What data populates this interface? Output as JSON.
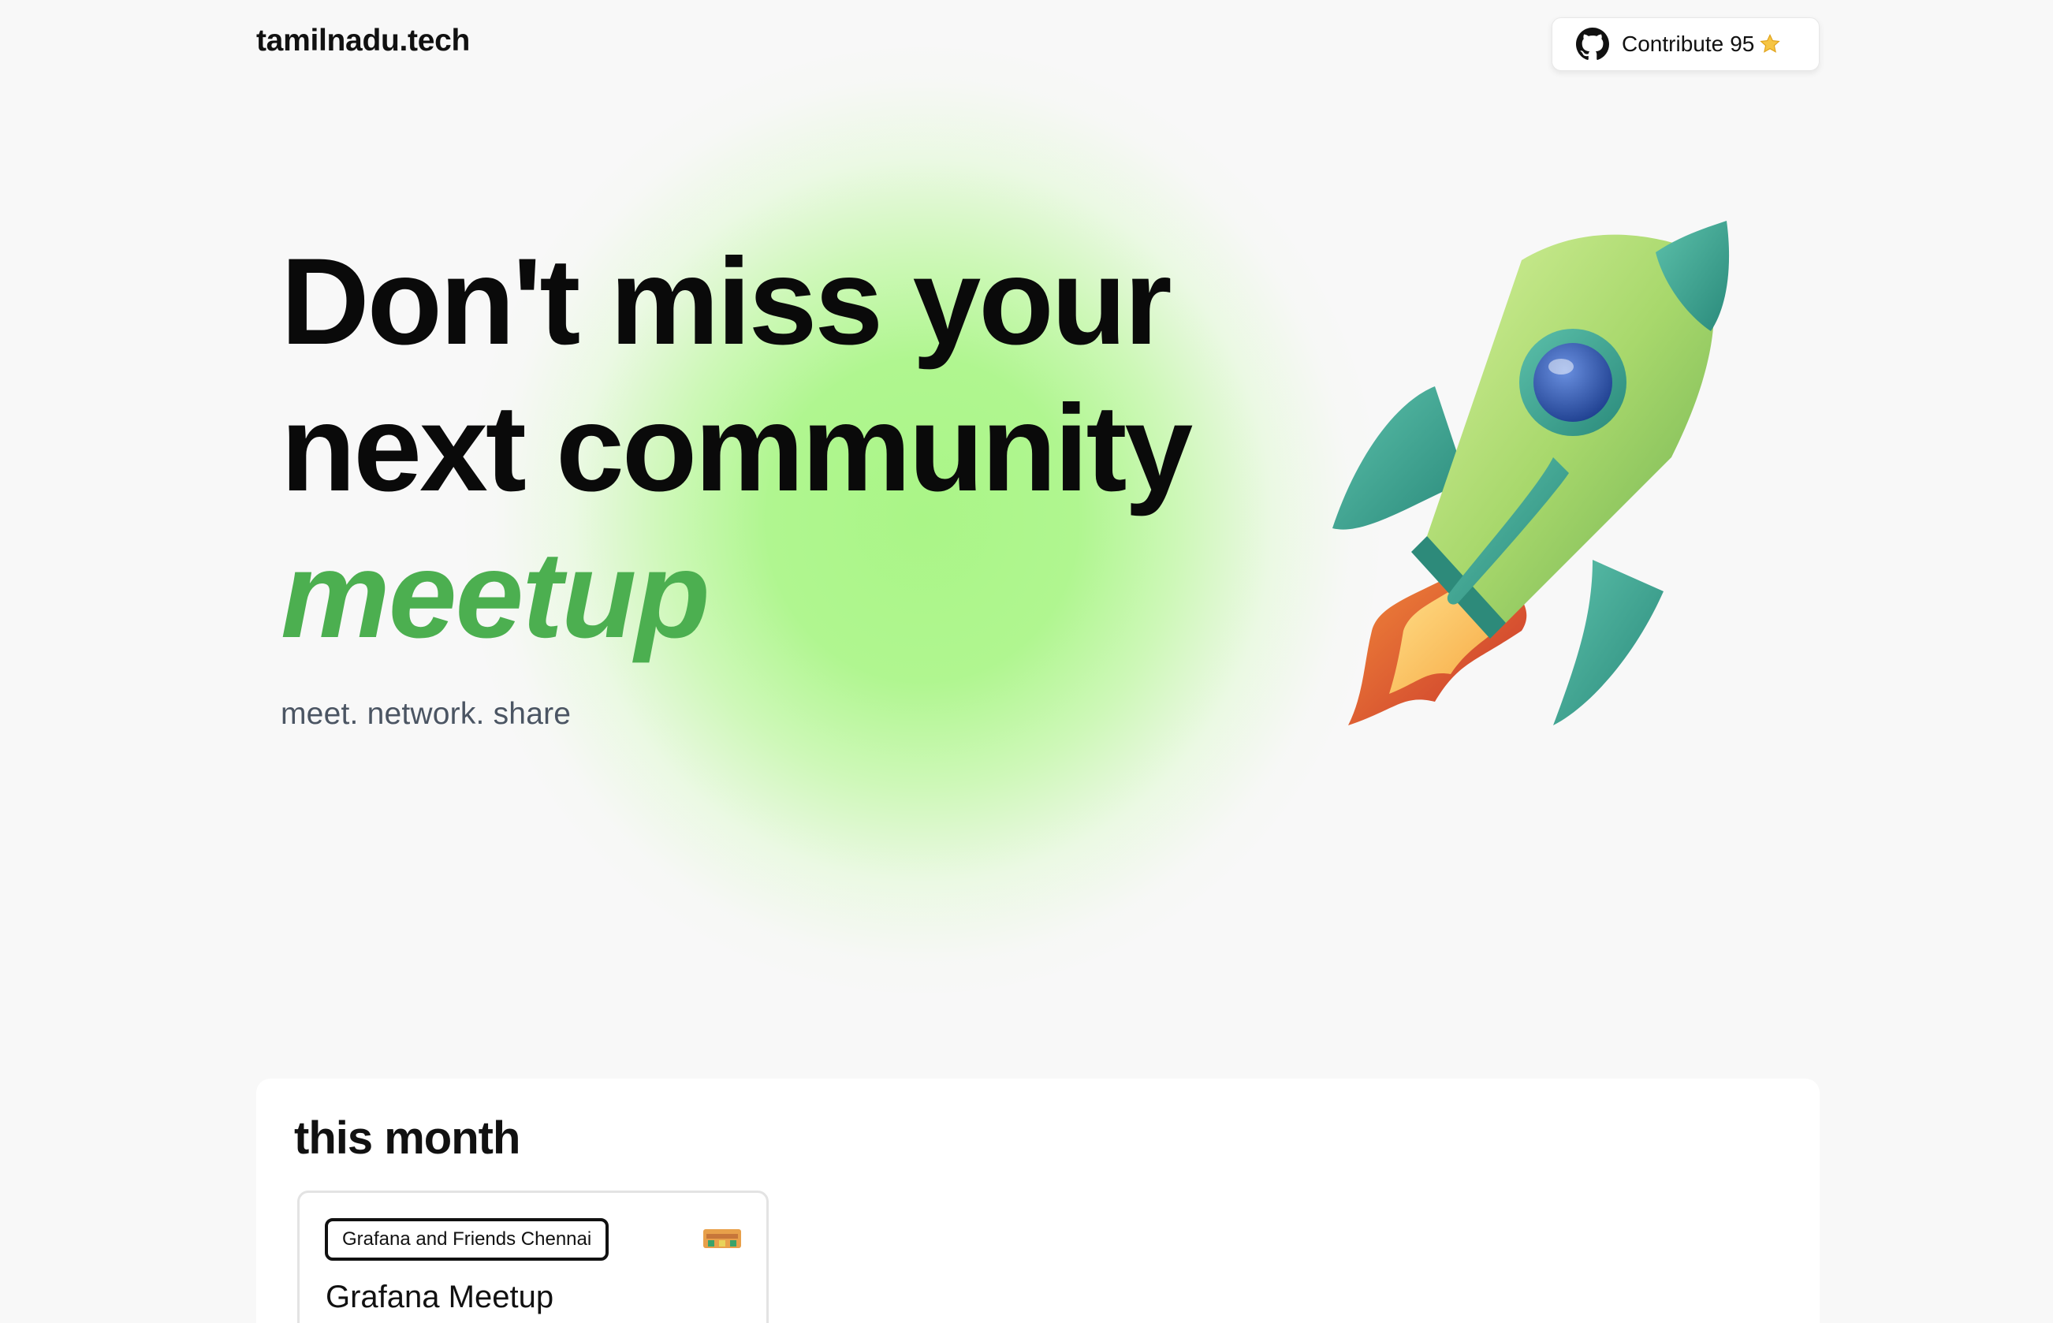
{
  "header": {
    "brand": "tamilnadu.tech",
    "contribute": {
      "label": "Contribute",
      "count": "95",
      "icon": "github-icon",
      "badge_icon": "star-icon"
    }
  },
  "hero": {
    "line1": "Don't miss your",
    "line2": "next community",
    "line3": "meetup",
    "tagline": "meet. network. share",
    "illustration": "rocket-illustration"
  },
  "this_month": {
    "title": "this month",
    "events": [
      {
        "community": "Grafana and Friends Chennai",
        "title": "Grafana Meetup"
      }
    ]
  },
  "colors": {
    "accent": "#4caf50",
    "glow": "#aaf587",
    "background": "#f8f8f8",
    "text": "#0b0b0b",
    "muted": "#4b5563"
  }
}
